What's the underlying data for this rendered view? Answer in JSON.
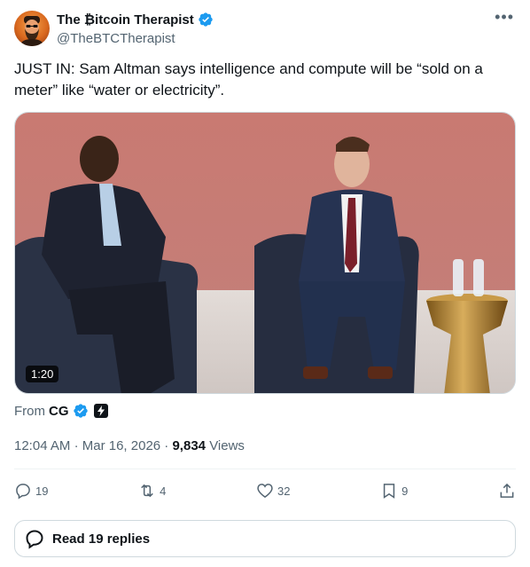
{
  "author": {
    "name": "The ₿itcoin Therapist",
    "handle": "@TheBTCTherapist",
    "verified": true
  },
  "tweet": {
    "text": "JUST IN: Sam Altman says intelligence and compute will be “sold on a meter” like “water or electricity”."
  },
  "media": {
    "type": "video",
    "duration": "1:20"
  },
  "attribution": {
    "prefix": "From",
    "source": "CG"
  },
  "meta": {
    "time": "12:04 AM",
    "separator": "·",
    "date": "Mar 16, 2026",
    "views_count": "9,834",
    "views_label": "Views"
  },
  "actions": {
    "replies": "19",
    "reposts": "4",
    "likes": "32",
    "bookmarks": "9"
  },
  "read_replies_label": "Read 19 replies",
  "colors": {
    "verified_blue": "#1d9bf0",
    "secondary_text": "#536471"
  }
}
